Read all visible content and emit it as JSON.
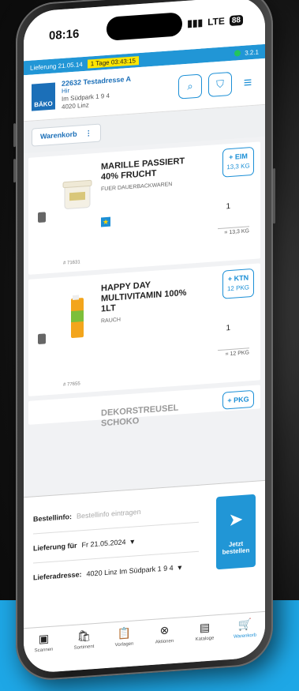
{
  "status_bar": {
    "time": "08:16",
    "network": "LTE",
    "battery": "88"
  },
  "info_bar": {
    "delivery": "Lieferung 21.05.14",
    "countdown": "1 Tage 03:43:15",
    "version": "3.2.1"
  },
  "header": {
    "logo_text": "BÄKO",
    "store_name": "22632 Testadresse A",
    "store_line2": "Hir",
    "store_line3": "Im Südpark 1 9 4",
    "store_line4": "4020 Linz"
  },
  "tab": {
    "label": "Warenkorb",
    "more": "⋮"
  },
  "products": [
    {
      "name": "MARILLE PASSIERT 40% FRUCHT",
      "brand": "FUER DAUERBACKWAREN",
      "add_label": "+ EIM",
      "add_sub": "13,3 KG",
      "qty": "1",
      "qty_unit": "= 13,3 KG",
      "art_no": "# 71631"
    },
    {
      "name": "HAPPY DAY MULTIVITAMIN 100% 1LT",
      "brand": "RAUCH",
      "add_label": "+ KTN",
      "add_sub": "12 PKG",
      "qty": "1",
      "qty_unit": "= 12 PKG",
      "art_no": "# 77655"
    }
  ],
  "partial_product": {
    "name": "DEKORSTREUSEL SCHOKO",
    "add_label": "+ PKG"
  },
  "order": {
    "bestellinfo_label": "Bestellinfo:",
    "bestellinfo_placeholder": "Bestellinfo eintragen",
    "lieferung_label": "Lieferung für",
    "lieferung_value": "Fr 21.05.2024",
    "adresse_label": "Lieferadresse:",
    "adresse_value": "4020 Linz Im Südpark 1 9 4",
    "button_label": "Jetzt bestellen"
  },
  "nav": [
    {
      "label": "Scannen",
      "icon": "▣"
    },
    {
      "label": "Sortiment",
      "icon": "🛍"
    },
    {
      "label": "Vorlagen",
      "icon": "📋"
    },
    {
      "label": "Aktionen",
      "icon": "⊗"
    },
    {
      "label": "Kataloge",
      "icon": "▤"
    },
    {
      "label": "Warenkorb",
      "icon": "🛒"
    }
  ]
}
